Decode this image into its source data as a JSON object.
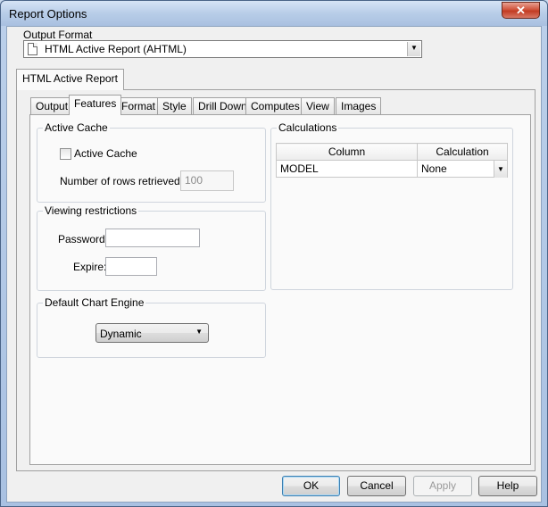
{
  "window": {
    "title": "Report Options",
    "close_glyph": "✕"
  },
  "output_format": {
    "label": "Output Format",
    "value": "HTML Active Report (AHTML)",
    "icon": "document-icon"
  },
  "outer_tab": {
    "label": "HTML Active Report"
  },
  "tabs": [
    {
      "label": "Output"
    },
    {
      "label": "Features"
    },
    {
      "label": "Format"
    },
    {
      "label": "Style"
    },
    {
      "label": "Drill Down"
    },
    {
      "label": "Computes"
    },
    {
      "label": "View"
    },
    {
      "label": "Images"
    }
  ],
  "active_cache": {
    "group_label": "Active Cache",
    "checkbox_label": "Active Cache",
    "checked": false,
    "rows_label": "Number of rows retrieved:",
    "rows_value": "100"
  },
  "viewing_restrictions": {
    "group_label": "Viewing restrictions",
    "password_label": "Password:",
    "password_value": "",
    "expire_label": "Expire:",
    "expire_value": ""
  },
  "chart_engine": {
    "group_label": "Default Chart Engine",
    "value": "Dynamic"
  },
  "calculations": {
    "group_label": "Calculations",
    "columns": [
      "Column",
      "Calculation"
    ],
    "rows": [
      {
        "column": "MODEL",
        "calculation": "None"
      }
    ]
  },
  "buttons": {
    "ok": "OK",
    "cancel": "Cancel",
    "apply": "Apply",
    "help": "Help"
  }
}
